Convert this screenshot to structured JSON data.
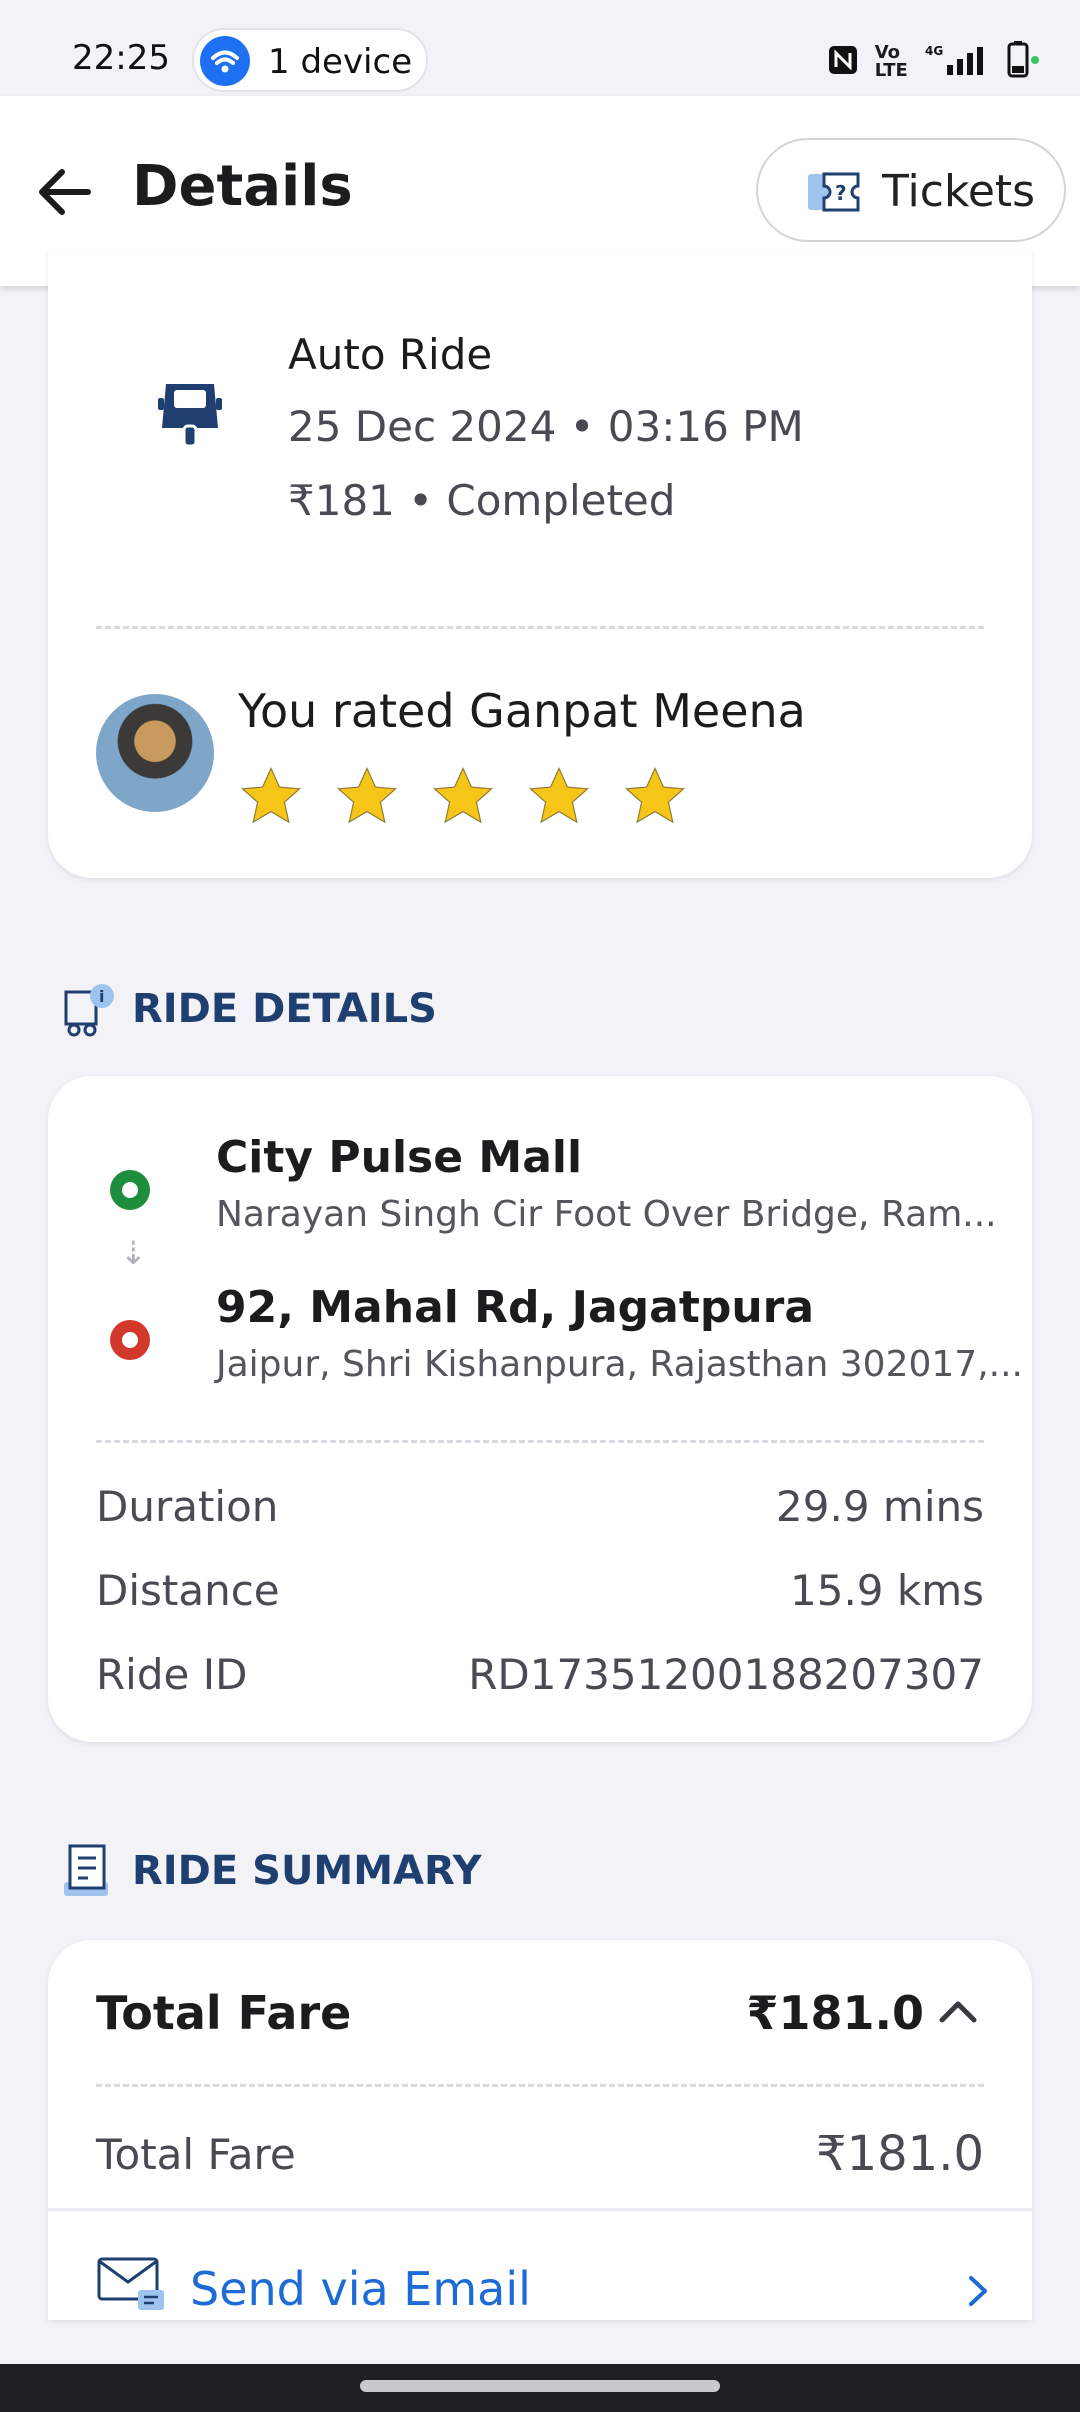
{
  "status_bar": {
    "time": "22:25",
    "device_label": "1 device",
    "icons": [
      "nfc-icon",
      "volte-icon",
      "signal-4g-icon",
      "battery-icon"
    ]
  },
  "header": {
    "title": "Details",
    "tickets_label": "Tickets"
  },
  "ride": {
    "type": "Auto Ride",
    "datetime": "25 Dec 2024 • 03:16 PM",
    "fare_status": "₹181 • Completed",
    "rating_text": "You rated Ganpat Meena",
    "rating": 5,
    "rating_max": 5
  },
  "ride_details": {
    "heading": "RIDE DETAILS",
    "pickup_name": "City Pulse Mall",
    "pickup_address": "Narayan Singh Cir Foot Over Bridge, Ram...",
    "drop_name": "92, Mahal Rd, Jagatpura",
    "drop_address": "Jaipur, Shri Kishanpura, Rajasthan 302017,...",
    "duration_label": "Duration",
    "duration_value": "29.9 mins",
    "distance_label": "Distance",
    "distance_value": "15.9 kms",
    "ride_id_label": "Ride ID",
    "ride_id_value": "RD17351200188207307"
  },
  "ride_summary": {
    "heading": "RIDE SUMMARY",
    "total_fare_label": "Total Fare",
    "total_fare_amount": "₹181.0",
    "line_label": "Total Fare",
    "line_value": "₹181.0",
    "email_label": "Send via Email"
  },
  "colors": {
    "accent_blue": "#1e6ad6",
    "heading_navy": "#1f3f70",
    "pickup_green": "#1e8e3e",
    "drop_red": "#d3392b",
    "star_yellow": "#f5c518"
  }
}
